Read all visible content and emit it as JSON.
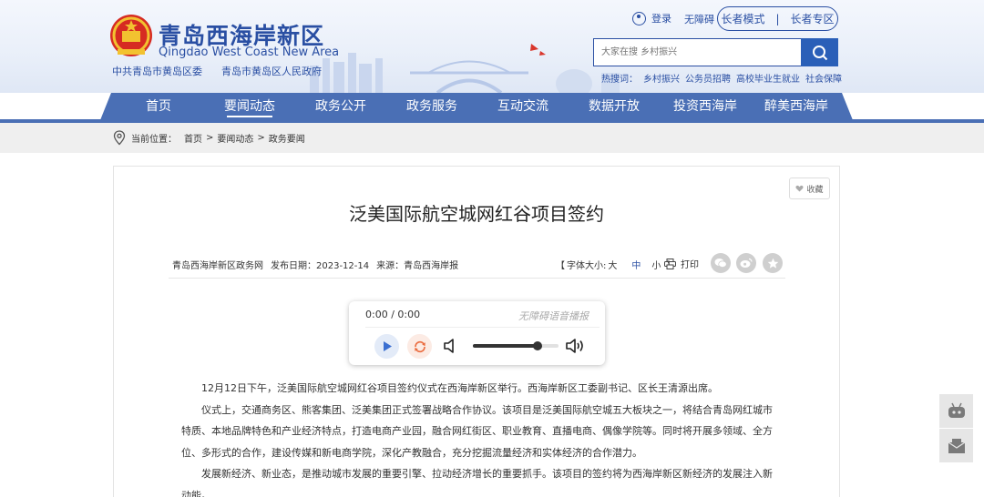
{
  "header": {
    "site_title": "青岛西海岸新区",
    "site_subtitle": "Qingdao West Coast New Area",
    "party_committee": "中共青岛市黄岛区委",
    "government": "青岛市黄岛区人民政府",
    "login_label": "登录",
    "accessibility_label": "无障碍",
    "elder_mode_label": "长者模式",
    "elder_zone_label": "长者专区",
    "search_placeholder": "大家在搜 乡村振兴",
    "hot_label": "热搜词：",
    "hot_terms": [
      "乡村振兴",
      "公务员招聘",
      "高校毕业生就业",
      "社会保障"
    ]
  },
  "nav": {
    "items": [
      "首页",
      "要闻动态",
      "政务公开",
      "政务服务",
      "互动交流",
      "数据开放",
      "投资西海岸",
      "醉美西海岸"
    ],
    "active_index": 1
  },
  "breadcrumb": {
    "label": "当前位置：",
    "items": [
      "首页",
      "要闻动态",
      "政务要闻"
    ],
    "sep": ">"
  },
  "article": {
    "favorite_label": "收藏",
    "title": "泛美国际航空城网红谷项目签约",
    "source_site": "青岛西海岸新区政务网",
    "publish_date": "发布日期：2023-12-14",
    "origin": "来源：青岛西海岸报",
    "font_size": {
      "open": "【",
      "label": "字体大小:",
      "large": "大",
      "medium": "中",
      "small": "小",
      "close": "】"
    },
    "print_label": "打印",
    "paragraphs": [
      "12月12日下午，泛美国际航空城网红谷项目签约仪式在西海岸新区举行。西海岸新区工委副书记、区长王清源出席。",
      "仪式上，交通商务区、熊客集团、泛美集团正式签署战略合作协议。该项目是泛美国际航空城五大板块之一，将结合青岛网红城市特质、本地品牌特色和产业经济特点，打造电商产业园，融合网红街区、职业教育、直播电商、偶像学院等。同时将开展多领域、全方位、多形式的合作，建设传媒和新电商学院，深化产教融合，充分挖掘流量经济和实体经济的合作潜力。",
      "发展新经济、新业态，是推动城市发展的重要引擎、拉动经济增长的重要抓手。该项目的签约将为西海岸新区新经济的发展注入新动能。"
    ]
  },
  "player": {
    "time": "0:00 / 0:00",
    "label": "无障碍语音播报",
    "volume": 0.75
  },
  "colors": {
    "brand": "#2a4fa3",
    "nav": "#4a6fb5",
    "search_button": "#2a5fb8"
  }
}
